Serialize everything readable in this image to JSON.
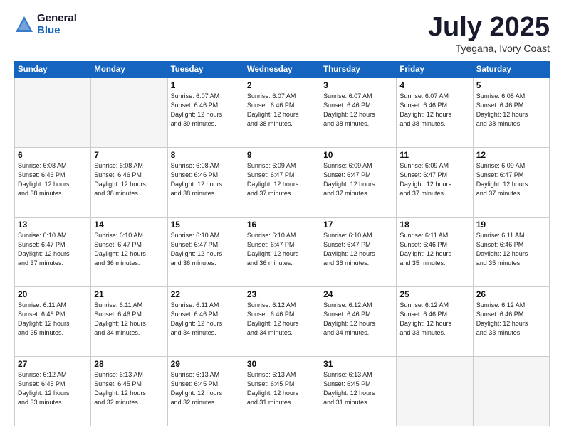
{
  "logo": {
    "general": "General",
    "blue": "Blue"
  },
  "header": {
    "month": "July 2025",
    "location": "Tyegana, Ivory Coast"
  },
  "weekdays": [
    "Sunday",
    "Monday",
    "Tuesday",
    "Wednesday",
    "Thursday",
    "Friday",
    "Saturday"
  ],
  "weeks": [
    [
      {
        "day": "",
        "info": ""
      },
      {
        "day": "",
        "info": ""
      },
      {
        "day": "1",
        "info": "Sunrise: 6:07 AM\nSunset: 6:46 PM\nDaylight: 12 hours\nand 39 minutes."
      },
      {
        "day": "2",
        "info": "Sunrise: 6:07 AM\nSunset: 6:46 PM\nDaylight: 12 hours\nand 38 minutes."
      },
      {
        "day": "3",
        "info": "Sunrise: 6:07 AM\nSunset: 6:46 PM\nDaylight: 12 hours\nand 38 minutes."
      },
      {
        "day": "4",
        "info": "Sunrise: 6:07 AM\nSunset: 6:46 PM\nDaylight: 12 hours\nand 38 minutes."
      },
      {
        "day": "5",
        "info": "Sunrise: 6:08 AM\nSunset: 6:46 PM\nDaylight: 12 hours\nand 38 minutes."
      }
    ],
    [
      {
        "day": "6",
        "info": "Sunrise: 6:08 AM\nSunset: 6:46 PM\nDaylight: 12 hours\nand 38 minutes."
      },
      {
        "day": "7",
        "info": "Sunrise: 6:08 AM\nSunset: 6:46 PM\nDaylight: 12 hours\nand 38 minutes."
      },
      {
        "day": "8",
        "info": "Sunrise: 6:08 AM\nSunset: 6:46 PM\nDaylight: 12 hours\nand 38 minutes."
      },
      {
        "day": "9",
        "info": "Sunrise: 6:09 AM\nSunset: 6:47 PM\nDaylight: 12 hours\nand 37 minutes."
      },
      {
        "day": "10",
        "info": "Sunrise: 6:09 AM\nSunset: 6:47 PM\nDaylight: 12 hours\nand 37 minutes."
      },
      {
        "day": "11",
        "info": "Sunrise: 6:09 AM\nSunset: 6:47 PM\nDaylight: 12 hours\nand 37 minutes."
      },
      {
        "day": "12",
        "info": "Sunrise: 6:09 AM\nSunset: 6:47 PM\nDaylight: 12 hours\nand 37 minutes."
      }
    ],
    [
      {
        "day": "13",
        "info": "Sunrise: 6:10 AM\nSunset: 6:47 PM\nDaylight: 12 hours\nand 37 minutes."
      },
      {
        "day": "14",
        "info": "Sunrise: 6:10 AM\nSunset: 6:47 PM\nDaylight: 12 hours\nand 36 minutes."
      },
      {
        "day": "15",
        "info": "Sunrise: 6:10 AM\nSunset: 6:47 PM\nDaylight: 12 hours\nand 36 minutes."
      },
      {
        "day": "16",
        "info": "Sunrise: 6:10 AM\nSunset: 6:47 PM\nDaylight: 12 hours\nand 36 minutes."
      },
      {
        "day": "17",
        "info": "Sunrise: 6:10 AM\nSunset: 6:47 PM\nDaylight: 12 hours\nand 36 minutes."
      },
      {
        "day": "18",
        "info": "Sunrise: 6:11 AM\nSunset: 6:46 PM\nDaylight: 12 hours\nand 35 minutes."
      },
      {
        "day": "19",
        "info": "Sunrise: 6:11 AM\nSunset: 6:46 PM\nDaylight: 12 hours\nand 35 minutes."
      }
    ],
    [
      {
        "day": "20",
        "info": "Sunrise: 6:11 AM\nSunset: 6:46 PM\nDaylight: 12 hours\nand 35 minutes."
      },
      {
        "day": "21",
        "info": "Sunrise: 6:11 AM\nSunset: 6:46 PM\nDaylight: 12 hours\nand 34 minutes."
      },
      {
        "day": "22",
        "info": "Sunrise: 6:11 AM\nSunset: 6:46 PM\nDaylight: 12 hours\nand 34 minutes."
      },
      {
        "day": "23",
        "info": "Sunrise: 6:12 AM\nSunset: 6:46 PM\nDaylight: 12 hours\nand 34 minutes."
      },
      {
        "day": "24",
        "info": "Sunrise: 6:12 AM\nSunset: 6:46 PM\nDaylight: 12 hours\nand 34 minutes."
      },
      {
        "day": "25",
        "info": "Sunrise: 6:12 AM\nSunset: 6:46 PM\nDaylight: 12 hours\nand 33 minutes."
      },
      {
        "day": "26",
        "info": "Sunrise: 6:12 AM\nSunset: 6:46 PM\nDaylight: 12 hours\nand 33 minutes."
      }
    ],
    [
      {
        "day": "27",
        "info": "Sunrise: 6:12 AM\nSunset: 6:45 PM\nDaylight: 12 hours\nand 33 minutes."
      },
      {
        "day": "28",
        "info": "Sunrise: 6:13 AM\nSunset: 6:45 PM\nDaylight: 12 hours\nand 32 minutes."
      },
      {
        "day": "29",
        "info": "Sunrise: 6:13 AM\nSunset: 6:45 PM\nDaylight: 12 hours\nand 32 minutes."
      },
      {
        "day": "30",
        "info": "Sunrise: 6:13 AM\nSunset: 6:45 PM\nDaylight: 12 hours\nand 31 minutes."
      },
      {
        "day": "31",
        "info": "Sunrise: 6:13 AM\nSunset: 6:45 PM\nDaylight: 12 hours\nand 31 minutes."
      },
      {
        "day": "",
        "info": ""
      },
      {
        "day": "",
        "info": ""
      }
    ]
  ]
}
